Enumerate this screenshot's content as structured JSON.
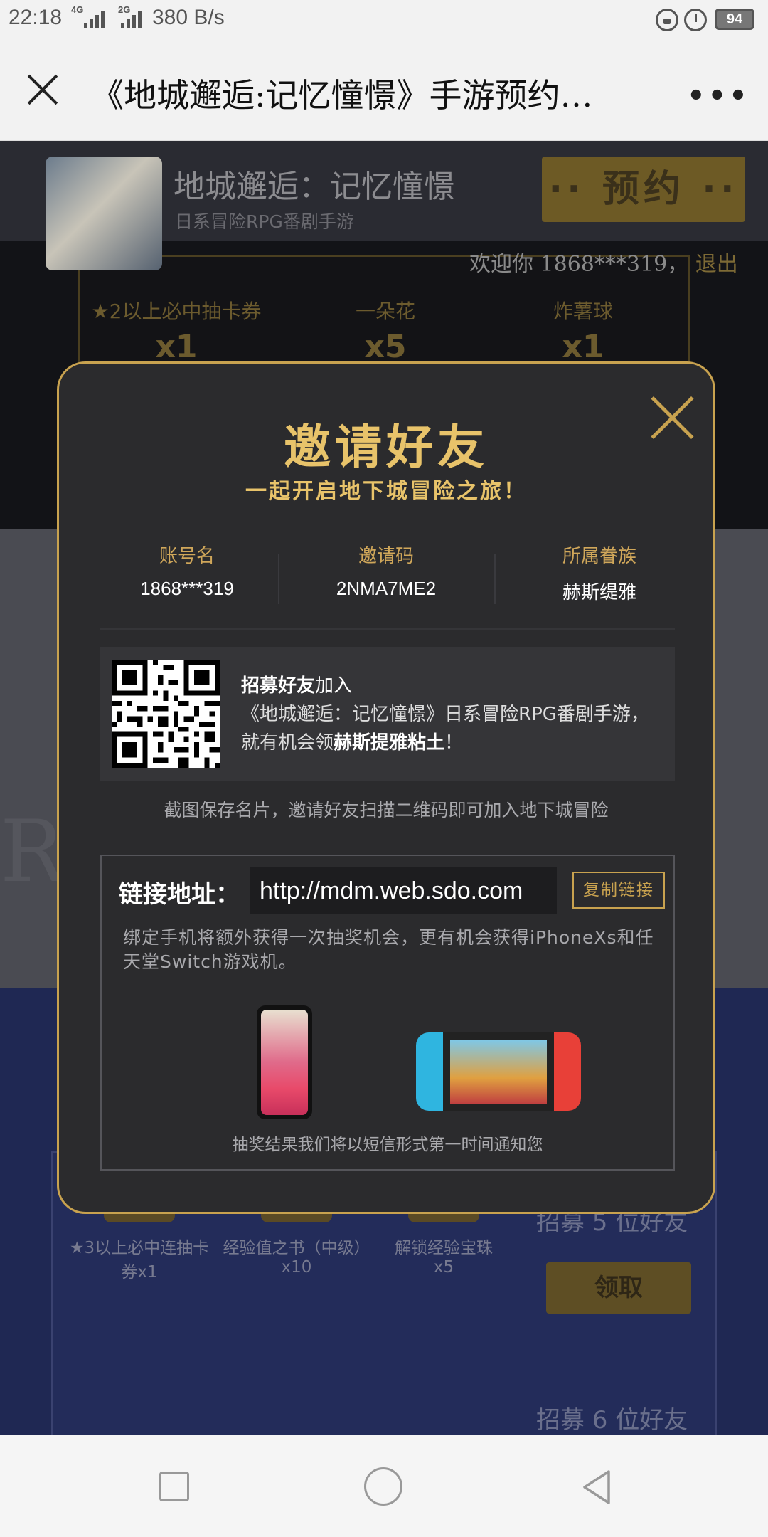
{
  "status_bar": {
    "time": "22:18",
    "network_1": "4G",
    "network_2": "2G",
    "data_rate": "380 B/s",
    "battery": "94",
    "icons": [
      "lock-rotation-icon",
      "alarm-icon",
      "battery-icon"
    ]
  },
  "title_bar": {
    "close_icon": "close-icon",
    "title": "《地城邂逅:记忆憧憬》手游预约…",
    "more_label": "…"
  },
  "game_header": {
    "name": "地城邂逅：记忆憧憬",
    "subtitle": "日系冒险RPG番剧手游",
    "reserve_label": "·· 预约 ··",
    "welcome_prefix": "欢迎你",
    "user": "1868***319，",
    "logout": "退出"
  },
  "top_prizes": [
    {
      "name": "★2以上必中抽卡券",
      "count": "x1"
    },
    {
      "name": "一朵花",
      "count": "x5"
    },
    {
      "name": "炸薯球",
      "count": "x1"
    }
  ],
  "background_deco": "R                                    R",
  "rewards": {
    "items": [
      {
        "name": "★3以上必中连抽卡券x1",
        "count": ""
      },
      {
        "name": "经验值之书（中级）",
        "count": "x10"
      },
      {
        "name": "解锁经验宝珠",
        "count": "x5"
      }
    ],
    "recruit_5": "招募 5 位好友",
    "claim_label": "领取",
    "recruit_6": "招募 6 位好友"
  },
  "modal": {
    "title": "邀请好友",
    "subtitle": "一起开启地下城冒险之旅！",
    "info": [
      {
        "label": "账号名",
        "value": "1868***319"
      },
      {
        "label": "邀请码",
        "value": "2NMA7ME2"
      },
      {
        "label": "所属眷族",
        "value": "赫斯缇雅"
      }
    ],
    "recruit_card": {
      "bold_1": "招募好友",
      "text_1": "加入",
      "text_2": "《地城邂逅：记忆憧憬》日系冒险RPG番剧手游，",
      "text_3": "就有机会领",
      "bold_2": "赫斯提雅粘土",
      "text_4": "！"
    },
    "save_tip": "截图保存名片，邀请好友扫描二维码即可加入地下城冒险",
    "link_label": "链接地址：",
    "link_value": "http://mdm.web.sdo.com",
    "copy_label": "复制链接",
    "bind_desc": "绑定手机将额外获得一次抽奖机会，更有机会获得iPhoneXs和任天堂Switch游戏机。",
    "result_tip": "抽奖结果我们将以短信形式第一时间通知您"
  },
  "colors": {
    "gold": "#c8a24f",
    "title_gold": "#e8c36a",
    "modal_bg": "#2b2b2d"
  }
}
